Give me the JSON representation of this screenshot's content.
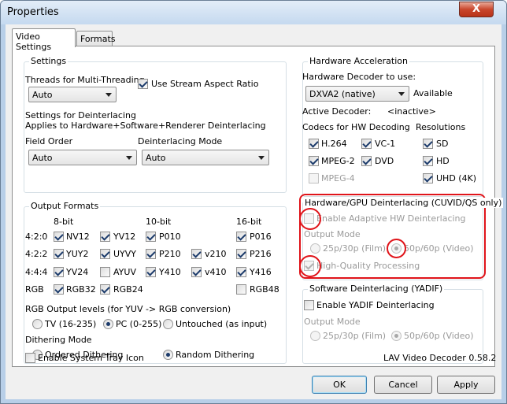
{
  "window": {
    "title": "Properties",
    "close": "X"
  },
  "tabs": [
    "Video Settings",
    "Formats"
  ],
  "settings": {
    "group": "Settings",
    "threads_label": "Threads for Multi-Threading",
    "threads_value": "Auto",
    "aspect_label": "Use Stream Aspect Ratio",
    "deint_title": "Settings for Deinterlacing",
    "deint_sub": "Applies to Hardware+Software+Renderer Deinterlacing",
    "field_order_label": "Field Order",
    "field_order_value": "Auto",
    "deint_mode_label": "Deinterlacing Mode",
    "deint_mode_value": "Auto"
  },
  "output": {
    "group": "Output Formats",
    "col_headers": [
      "8-bit",
      "10-bit",
      "16-bit"
    ],
    "rows": [
      {
        "label": "4:2:0",
        "items": [
          "NV12",
          "YV12",
          "P010",
          "",
          "P016"
        ]
      },
      {
        "label": "4:2:2",
        "items": [
          "YUY2",
          "UYVY",
          "P210",
          "v210",
          "P216"
        ]
      },
      {
        "label": "4:4:4",
        "items": [
          "YV24",
          "AYUV",
          "Y410",
          "v410",
          "Y416"
        ]
      },
      {
        "label": "RGB",
        "items": [
          "RGB32",
          "RGB24",
          "",
          "",
          "RGB48"
        ]
      }
    ],
    "rgb_levels_label": "RGB Output levels (for YUV -> RGB conversion)",
    "rgb_levels": [
      "TV (16-235)",
      "PC (0-255)",
      "Untouched (as input)"
    ],
    "dither_label": "Dithering Mode",
    "dither": [
      "Ordered Dithering",
      "Random Dithering"
    ]
  },
  "hw": {
    "group": "Hardware Acceleration",
    "decoder_label": "Hardware Decoder to use:",
    "decoder_value": "DXVA2 (native)",
    "available": "Available",
    "active_label": "Active Decoder:",
    "active_value": "<inactive>",
    "codecs_label": "Codecs for HW Decoding",
    "res_label": "Resolutions",
    "codecs": [
      "H.264",
      "VC-1",
      "MPEG-2",
      "DVD",
      "MPEG-4"
    ],
    "resolutions": [
      "SD",
      "HD",
      "UHD (4K)"
    ]
  },
  "hwdeint": {
    "group": "Hardware/GPU Deinterlacing (CUVID/QS only)",
    "enable": "Enable Adaptive HW Deinterlacing",
    "output_mode": "Output Mode",
    "opt1": "25p/30p (Film)",
    "opt2": "50p/60p (Video)",
    "hq": "High-Quality Processing"
  },
  "swdeint": {
    "group": "Software Deinterlacing (YADIF)",
    "enable": "Enable YADIF Deinterlacing",
    "output_mode": "Output Mode",
    "opt1": "25p/30p (Film)",
    "opt2": "50p/60p (Video)"
  },
  "footer": {
    "tray": "Enable System Tray Icon",
    "version": "LAV Video Decoder 0.58.2"
  },
  "buttons": {
    "ok": "OK",
    "cancel": "Cancel",
    "apply": "Apply"
  },
  "highlight_color": "#e0141a"
}
